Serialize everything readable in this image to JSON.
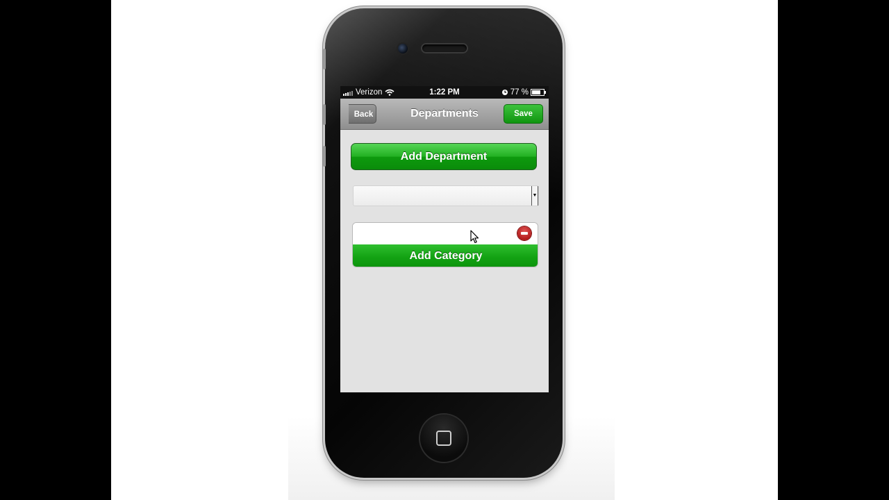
{
  "status_bar": {
    "carrier": "Verizon",
    "time": "1:22 PM",
    "battery": "77 %",
    "battery_level": 0.77
  },
  "nav": {
    "title": "Departments",
    "back_label": "Back",
    "save_label": "Save"
  },
  "main": {
    "add_department_label": "Add Department",
    "department_select_value": "",
    "category_input_value": "",
    "add_category_label": "Add Category"
  },
  "icons": {
    "signal": "signal-bars-icon",
    "wifi": "wifi-icon",
    "alarm": "alarm-clock-icon",
    "battery": "battery-icon",
    "remove": "remove-circle-icon",
    "dropdown": "chevron-down-icon",
    "cursor": "mouse-pointer-icon"
  },
  "colors": {
    "accent_green": "#13a213",
    "nav_gray": "#8f8f8f",
    "remove_red": "#b01818"
  }
}
